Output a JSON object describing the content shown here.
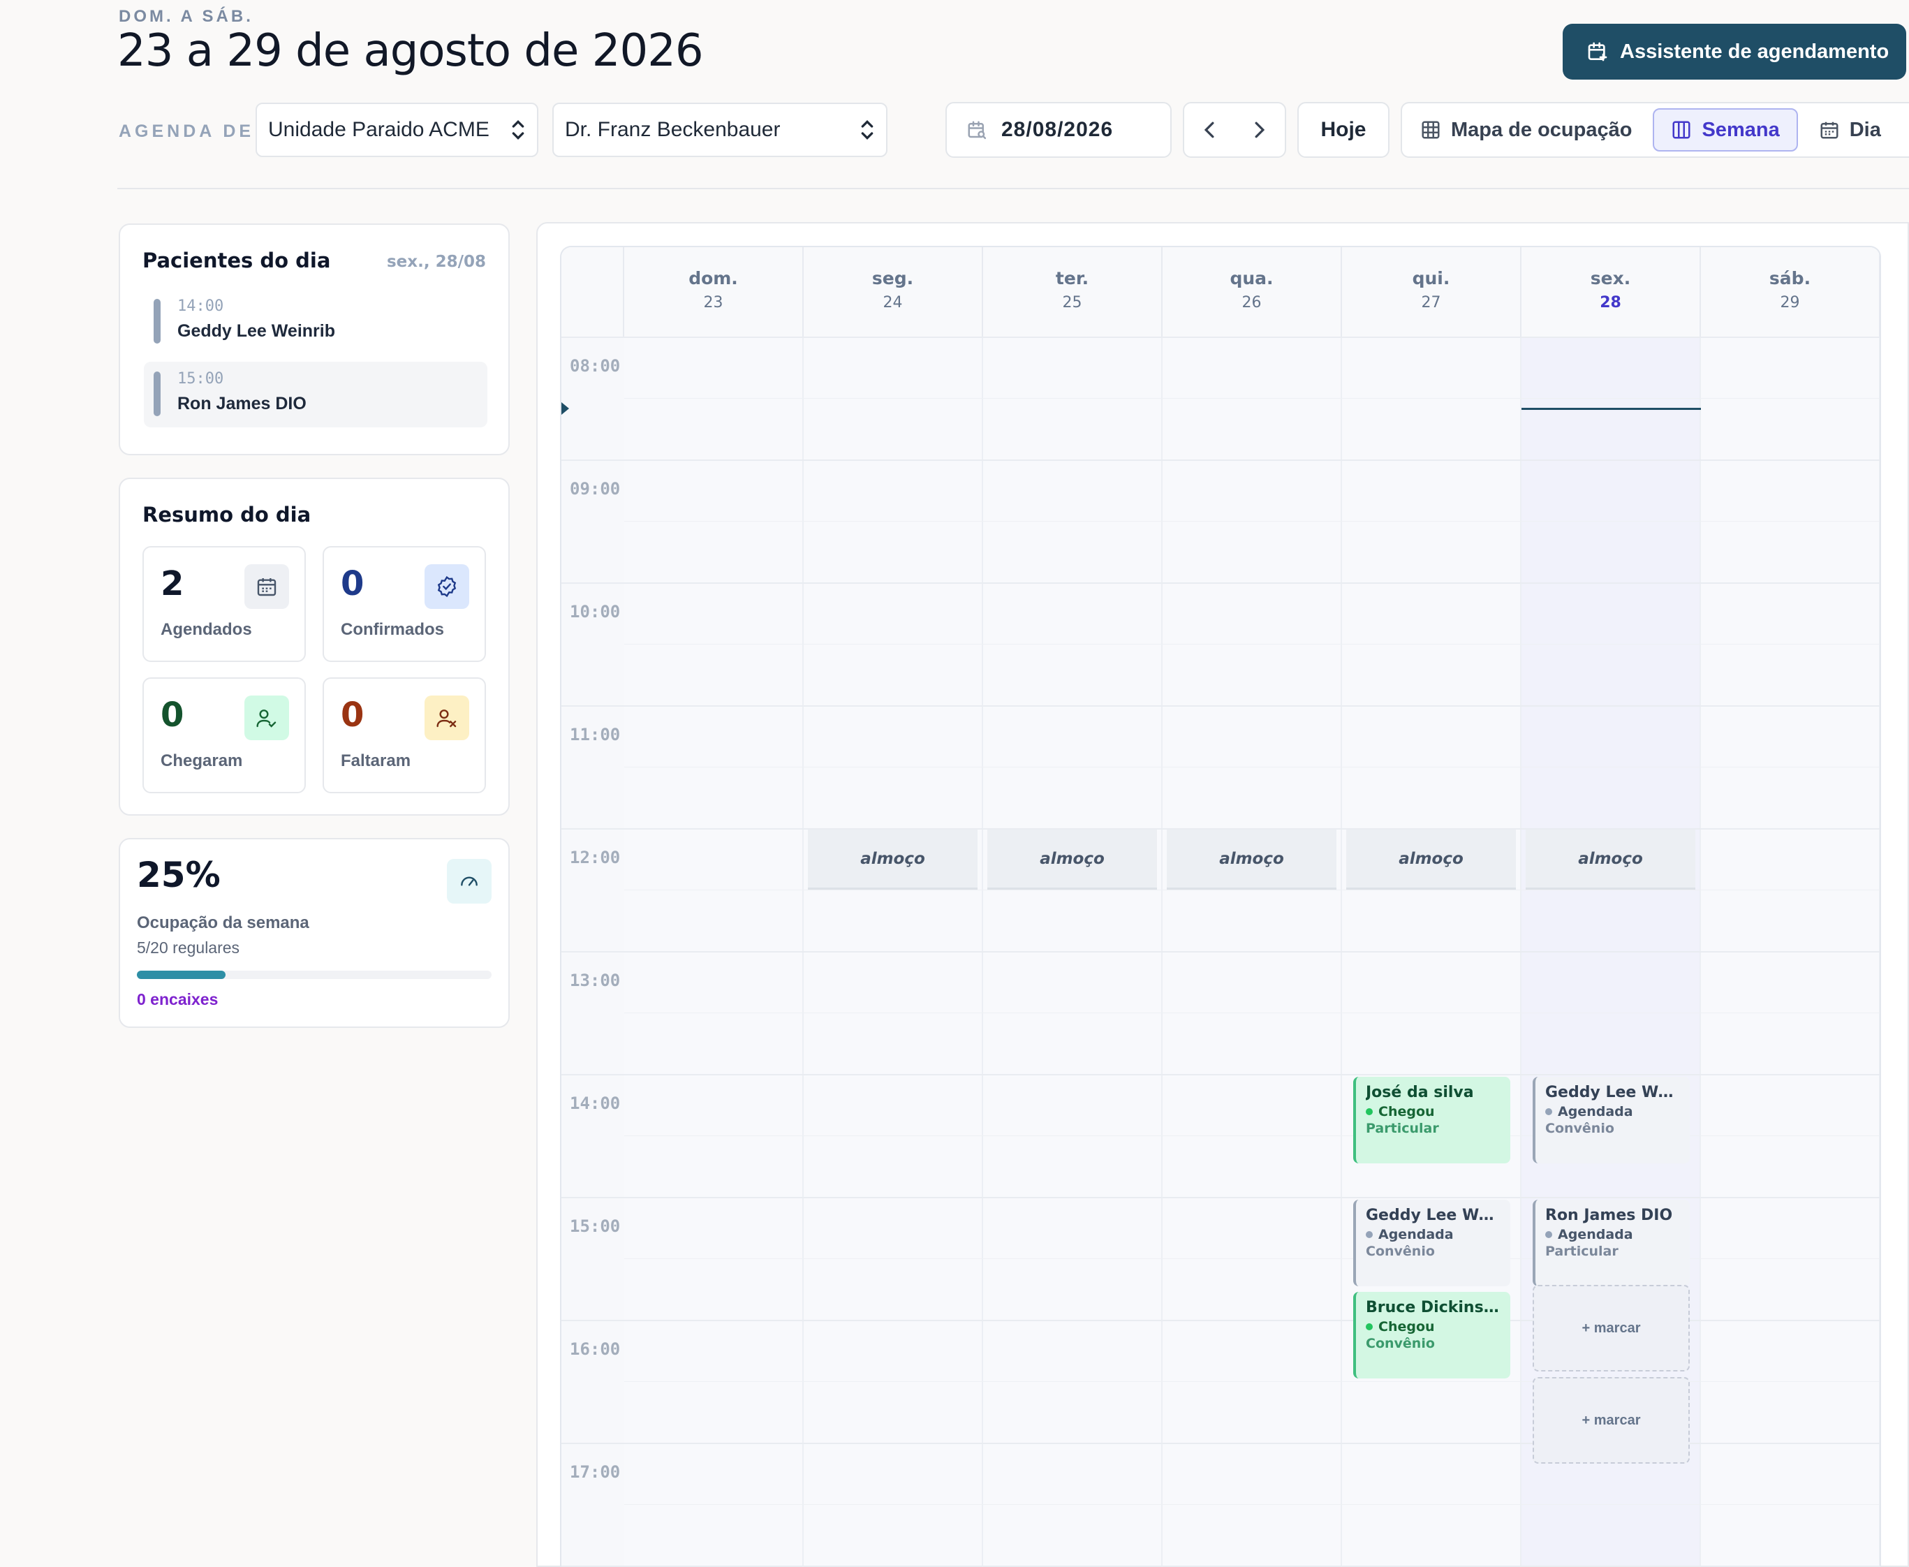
{
  "header": {
    "eyebrow": "DOM. A SÁB.",
    "title": "23 a 29 de agosto de 2026",
    "assistant_button": "Assistente de agendamento"
  },
  "toolbar": {
    "agenda_label": "AGENDA DE",
    "unit_select": "Unidade Paraido ACME",
    "doctor_select": "Dr. Franz Beckenbauer",
    "date_value": "28/08/2026",
    "today_button": "Hoje",
    "view_occupancy": "Mapa de ocupação",
    "view_week": "Semana",
    "view_day": "Dia",
    "active_view": "Semana"
  },
  "patients_card": {
    "title": "Pacientes do dia",
    "date": "sex., 28/08",
    "items": [
      {
        "time": "14:00",
        "name": "Geddy Lee Weinrib"
      },
      {
        "time": "15:00",
        "name": "Ron James DIO"
      }
    ]
  },
  "summary_card": {
    "title": "Resumo do dia",
    "stats": [
      {
        "value": "2",
        "label": "Agendados",
        "icon": "calendar-icon",
        "color": "#0f172a"
      },
      {
        "value": "0",
        "label": "Confirmados",
        "icon": "check-badge-icon",
        "color": "#1e3a8a"
      },
      {
        "value": "0",
        "label": "Chegaram",
        "icon": "user-check-icon",
        "color": "#14532d"
      },
      {
        "value": "0",
        "label": "Faltaram",
        "icon": "user-x-icon",
        "color": "#9a3412"
      }
    ]
  },
  "occupancy_card": {
    "percent": "25%",
    "label": "Ocupação da semana",
    "regular": "5/20 regulares",
    "fits": "0 encaixes",
    "progress": 0.25,
    "icon": "gauge-icon"
  },
  "calendar": {
    "days": [
      {
        "name": "dom.",
        "date": "23"
      },
      {
        "name": "seg.",
        "date": "24"
      },
      {
        "name": "ter.",
        "date": "25"
      },
      {
        "name": "qua.",
        "date": "26"
      },
      {
        "name": "qui.",
        "date": "27"
      },
      {
        "name": "sex.",
        "date": "28"
      },
      {
        "name": "sáb.",
        "date": "29"
      }
    ],
    "today_index": 5,
    "hours": [
      "08:00",
      "09:00",
      "10:00",
      "11:00",
      "12:00",
      "13:00",
      "14:00",
      "15:00",
      "16:00",
      "17:00"
    ],
    "lunch_label": "almoço",
    "lunch_days": [
      1,
      2,
      3,
      4,
      5
    ],
    "slot_label": "+ marcar",
    "appointments": [
      {
        "day": 4,
        "start": "14:00",
        "name": "José da silva",
        "status": "Chegou",
        "type": "Particular",
        "style": "green"
      },
      {
        "day": 4,
        "start": "15:00",
        "name": "Geddy Lee Weinrib",
        "status": "Agendada",
        "type": "Convênio",
        "style": "gray"
      },
      {
        "day": 4,
        "start": "15:45",
        "name": "Bruce Dickinson",
        "status": "Chegou",
        "type": "Convênio",
        "style": "green"
      },
      {
        "day": 5,
        "start": "14:00",
        "name": "Geddy Lee Weinrib",
        "status": "Agendada",
        "type": "Convênio",
        "style": "gray"
      },
      {
        "day": 5,
        "start": "15:00",
        "name": "Ron James DIO",
        "status": "Agendada",
        "type": "Particular",
        "style": "gray"
      }
    ],
    "open_slots": [
      {
        "day": 5,
        "start": "15:45"
      },
      {
        "day": 5,
        "start": "16:30"
      }
    ]
  }
}
